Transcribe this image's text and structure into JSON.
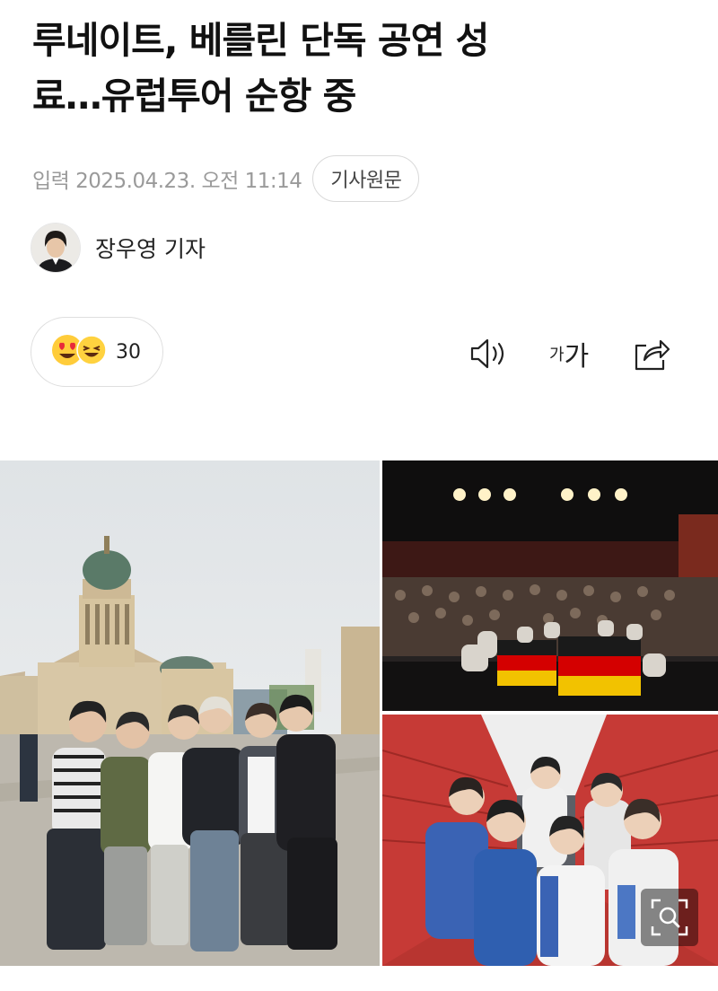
{
  "article": {
    "title_line1": "루네이트, 베를린 단독 공연 성",
    "title_line2": "료…유럽투어 순항 중",
    "date": "입력 2025.04.23. 오전 11:14",
    "source_button": "기사원문",
    "author": "장우영 기자"
  },
  "reactions": {
    "count": "30",
    "icons": [
      "heart-eyes-emoji",
      "laughing-emoji"
    ]
  },
  "toolbar": {
    "audio_icon": "speaker-icon",
    "font_small": "가",
    "font_big": "가",
    "share_icon": "share-icon"
  },
  "photos": {
    "main": "group-photo-berlin-cathedral",
    "top_right": "concert-stage-german-flag",
    "bottom_right": "group-photo-red-corridor",
    "zoom_icon": "zoom-icon"
  },
  "colors": {
    "text": "#111111",
    "meta": "#9a9a9a",
    "border": "#dedede",
    "flag_black": "#1a1a1a",
    "flag_red": "#d40000",
    "flag_gold": "#f2c200",
    "wall_red": "#c63a36"
  }
}
